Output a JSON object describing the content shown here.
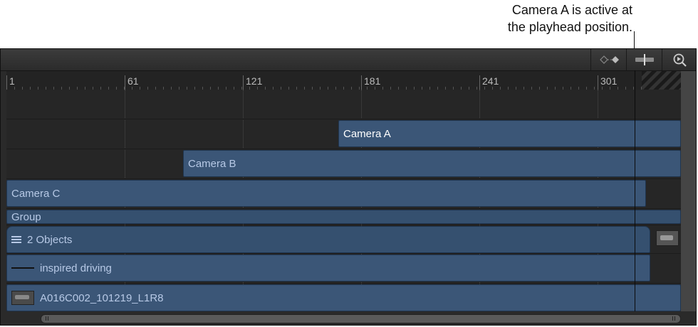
{
  "annotation": {
    "line1": "Camera A is active at",
    "line2": "the playhead position."
  },
  "toolbar": {
    "keyframe_icon": "keyframe-diamond-icon",
    "snap_icon": "snap-toggle-icon",
    "zoom_icon": "zoom-icon"
  },
  "ruler": {
    "ticks": [
      "1",
      "61",
      "121",
      "181",
      "241",
      "301"
    ]
  },
  "tracks": {
    "camera_a": "Camera A",
    "camera_b": "Camera B",
    "camera_c": "Camera C",
    "group": "Group",
    "objects": "2 Objects",
    "audio": "inspired driving",
    "clip": "A016C002_101219_L1R8"
  },
  "colors": {
    "track_bar": "#3b5677",
    "track_text": "#b7c9e6",
    "panel_bg": "#2a2a2a"
  }
}
